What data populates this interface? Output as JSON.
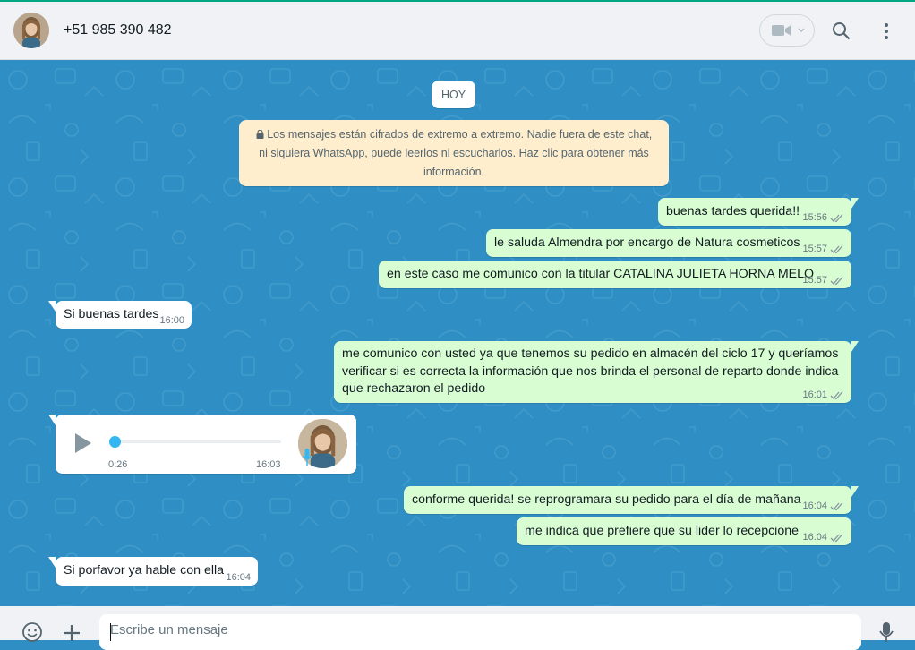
{
  "header": {
    "contact_name": "+51 985 390 482",
    "icons": [
      "avatar",
      "video-call-icon",
      "chevron-down-icon",
      "search-icon",
      "menu-dots-icon"
    ]
  },
  "chat": {
    "day_label": "HOY",
    "encryption_notice": "Los mensajes están cifrados de extremo a extremo. Nadie fuera de este chat, ni siquiera WhatsApp, puede leerlos ni escucharlos. Haz clic para obtener más información.",
    "messages": [
      {
        "dir": "out",
        "text": "buenas tardes querida!!",
        "time": "15:56",
        "status": "read"
      },
      {
        "dir": "out",
        "text": "le saluda Almendra por encargo de Natura cosmeticos",
        "time": "15:57",
        "status": "read"
      },
      {
        "dir": "out",
        "text": "en este caso me comunico con la titular CATALINA JULIETA HORNA MELO",
        "time": "15:57",
        "status": "read"
      },
      {
        "dir": "in",
        "text": "Si buenas tardes",
        "time": "16:00"
      },
      {
        "dir": "out",
        "text": "me comunico con usted ya que tenemos su pedido en almacén del ciclo 17 y queríamos verificar si es correcta la información que nos brinda el personal de reparto donde indica que rechazaron el pedido",
        "time": "16:01",
        "status": "read"
      },
      {
        "dir": "in",
        "type": "voice",
        "duration": "0:26",
        "time": "16:03"
      },
      {
        "dir": "out",
        "text": "conforme querida! se reprogramara su pedido para el día de mañana",
        "time": "16:04",
        "status": "read"
      },
      {
        "dir": "out",
        "text": "me indica que prefiere que su lider lo recepcione",
        "time": "16:04",
        "status": "read"
      },
      {
        "dir": "in",
        "text": "Si porfavor ya hable con ella",
        "time": "16:04"
      }
    ]
  },
  "composer": {
    "placeholder": "Escribe un mensaje",
    "icons": [
      "emoji-icon",
      "attach-plus-icon",
      "microphone-icon"
    ]
  },
  "colors": {
    "accent": "#00a884",
    "chat_background": "#2f8fc4",
    "outgoing_bubble": "#d9fdd3",
    "incoming_bubble": "#ffffff",
    "read_check": "#8696a0",
    "notice_background": "#ffeecd"
  }
}
